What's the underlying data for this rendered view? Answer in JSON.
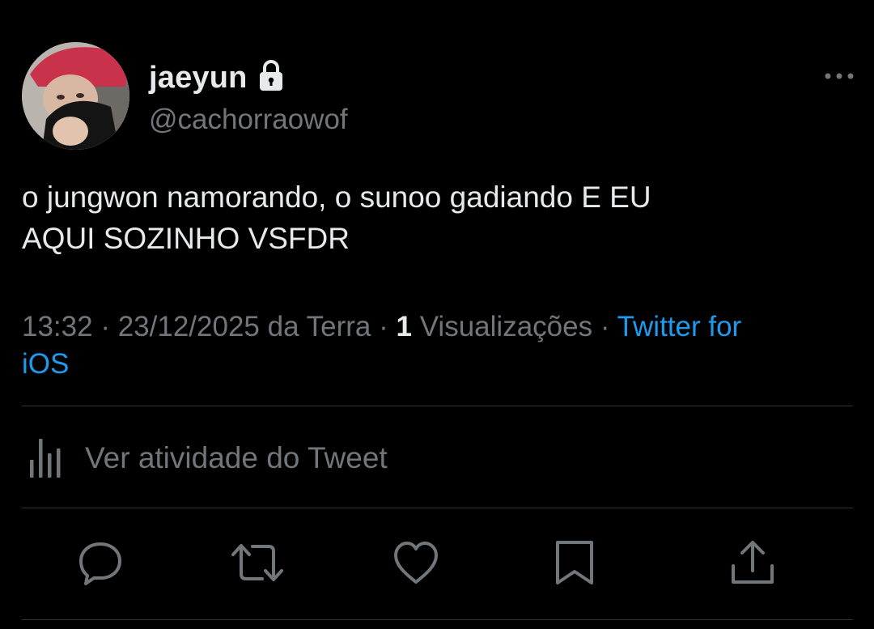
{
  "author": {
    "display_name": "jaeyun",
    "handle": "@cachorraowof",
    "avatar_icon": "profile-photo",
    "locked_icon": "lock-icon"
  },
  "tweet": {
    "text_line1": "o jungwon namorando, o sunoo gadiando E EU",
    "text_line2": "AQUI SOZINHO VSFDR"
  },
  "meta": {
    "time": "13:32",
    "separator": "·",
    "date": "23/12/2025",
    "location": "da Terra",
    "views_count": "1",
    "views_label": "Visualizações",
    "source_line1": "Twitter for",
    "source_line2": "iOS"
  },
  "activity": {
    "label": "Ver atividade do Tweet",
    "icon": "analytics-bars-icon"
  },
  "actions": [
    {
      "name": "reply",
      "icon": "speech-bubble-icon"
    },
    {
      "name": "retweet",
      "icon": "retweet-arrows-icon"
    },
    {
      "name": "like",
      "icon": "heart-icon"
    },
    {
      "name": "bookmark",
      "icon": "bookmark-icon"
    },
    {
      "name": "share",
      "icon": "share-upload-icon"
    }
  ],
  "colors": {
    "background": "#000000",
    "primary_text": "#e7e9ea",
    "secondary_text": "#71767b",
    "link": "#1d9bf0",
    "divider": "#2f3336"
  }
}
